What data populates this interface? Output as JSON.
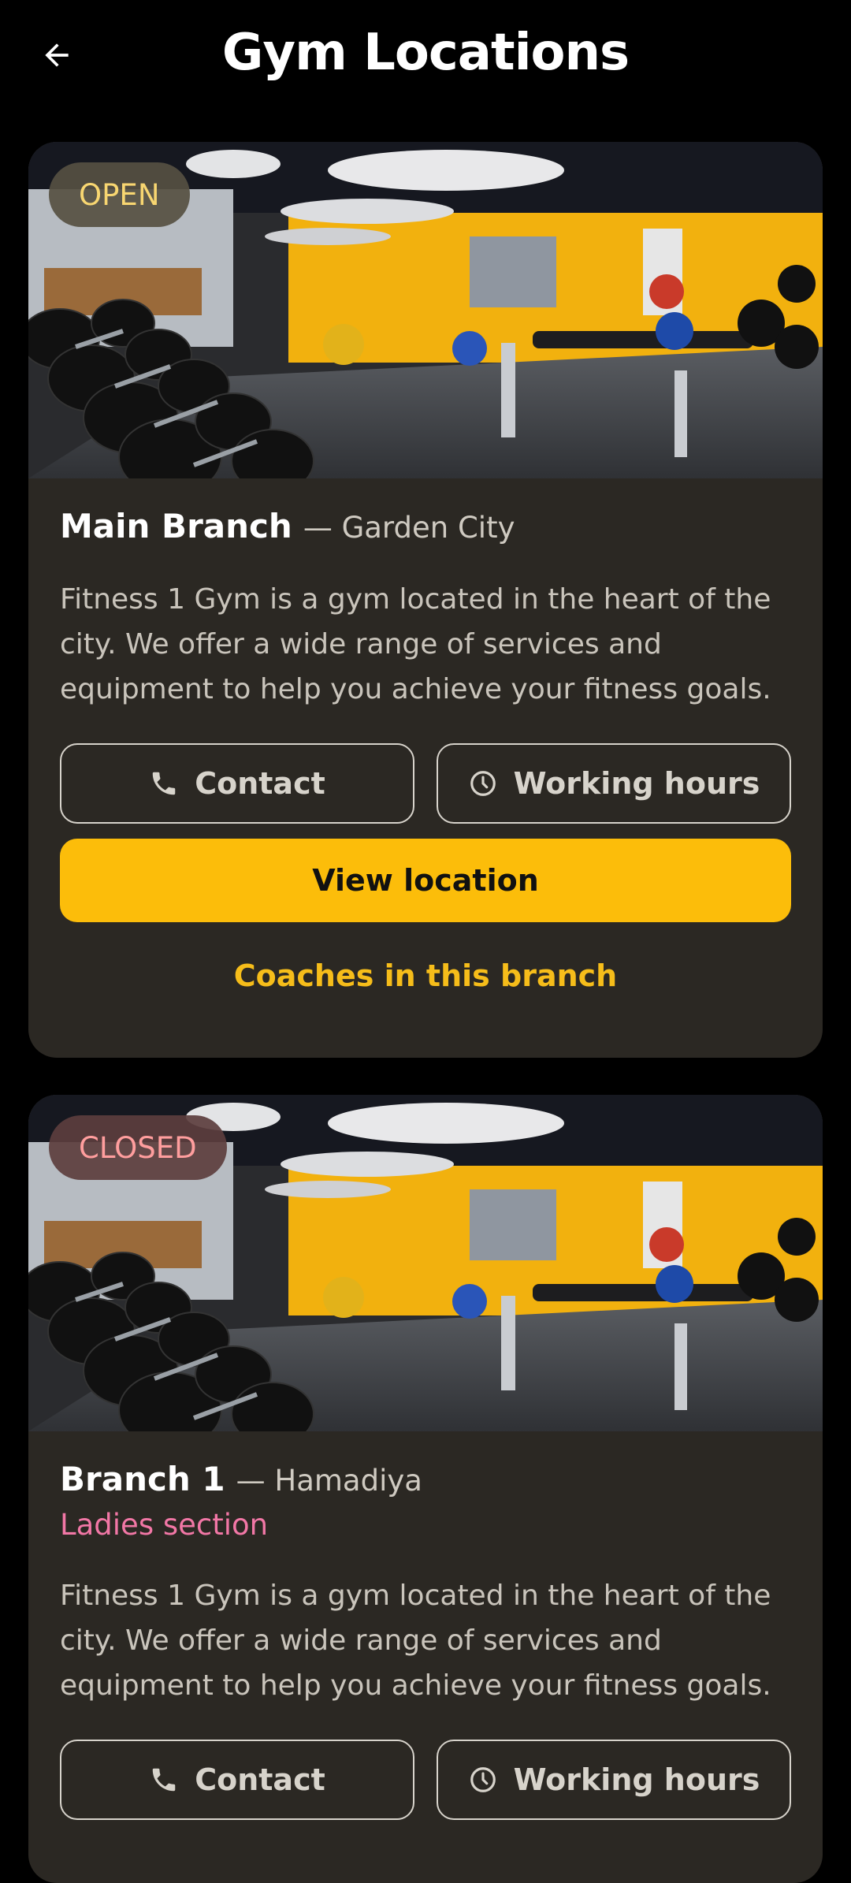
{
  "header": {
    "title": "Gym Locations",
    "back_icon": "arrow-left-icon"
  },
  "colors": {
    "background": "#000000",
    "card": "#2b2823",
    "accent": "#fcbd0a",
    "open": "#f8d671",
    "closed": "#ff9e9e",
    "ladies": "#f277a6"
  },
  "branches": [
    {
      "status": "OPEN",
      "name": "Main Branch",
      "area": "— Garden City",
      "section": "",
      "description": "Fitness 1 Gym is a gym located in the heart of the city. We offer a wide range of services and equipment to help you achieve your fitness goals.",
      "contact_label": "Contact",
      "hours_label": "Working hours",
      "view_label": "View location",
      "coaches_label": "Coaches in this branch"
    },
    {
      "status": "CLOSED",
      "name": "Branch 1",
      "area": "— Hamadiya",
      "section": "Ladies section",
      "description": "Fitness 1 Gym is a gym located in the heart of the city. We offer a wide range of services and equipment to help you achieve your fitness goals.",
      "contact_label": "Contact",
      "hours_label": "Working hours"
    }
  ]
}
